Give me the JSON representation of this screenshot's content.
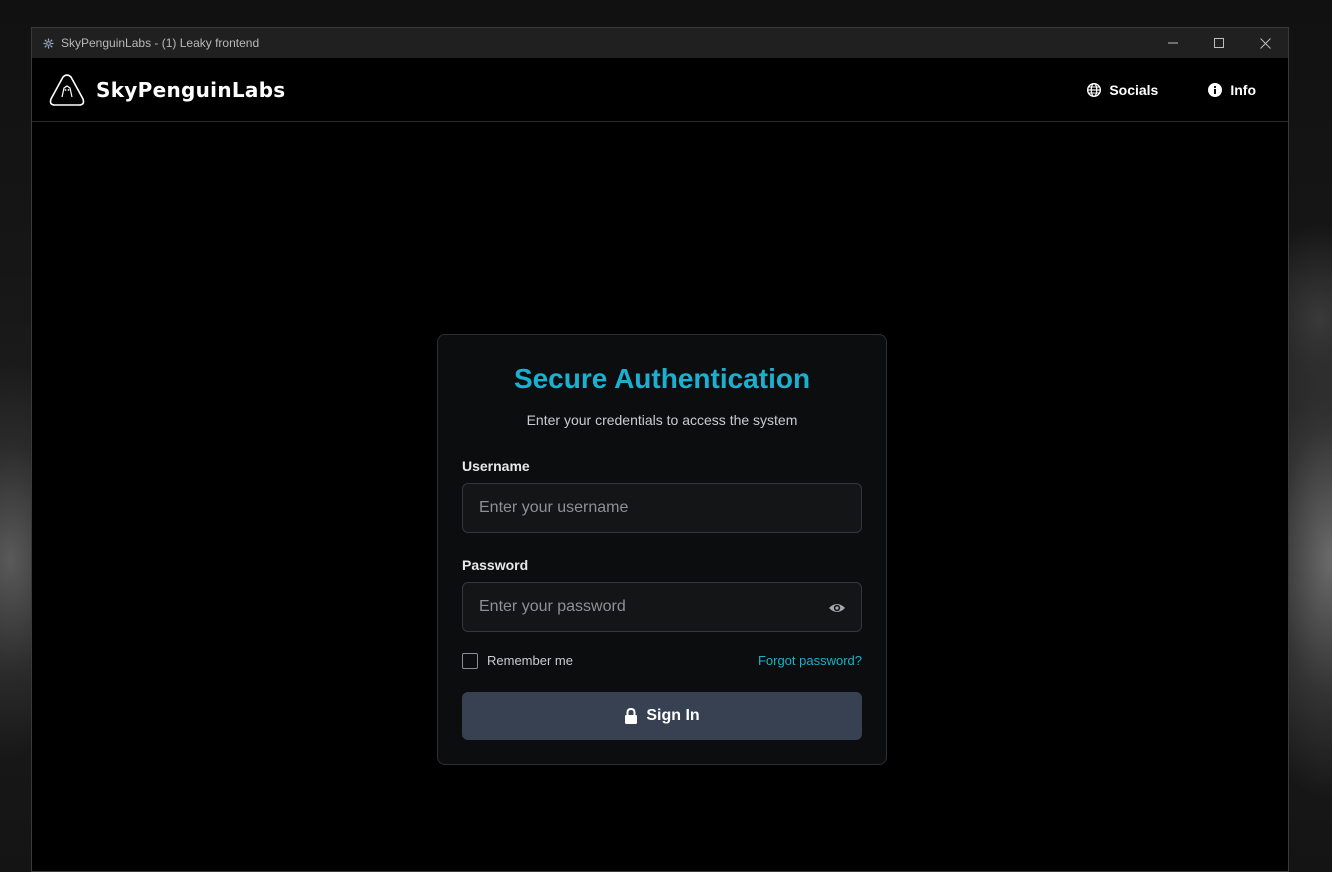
{
  "window": {
    "title": "SkyPenguinLabs - (1) Leaky frontend",
    "minimize_icon": "minimize-icon",
    "maximize_icon": "maximize-icon",
    "close_icon": "close-icon"
  },
  "navbar": {
    "brand": "SkyPenguinLabs",
    "links": [
      {
        "label": "Socials",
        "icon": "globe-icon"
      },
      {
        "label": "Info",
        "icon": "info-icon"
      }
    ]
  },
  "login": {
    "title": "Secure Authentication",
    "subtitle": "Enter your credentials to access the system",
    "username_label": "Username",
    "username_placeholder": "Enter your username",
    "username_value": "",
    "password_label": "Password",
    "password_placeholder": "Enter your password",
    "password_value": "",
    "remember_label": "Remember me",
    "remember_checked": false,
    "forgot_label": "Forgot password?",
    "submit_label": "Sign In",
    "submit_icon": "lock-icon"
  },
  "colors": {
    "accent": "#1ab0cf",
    "button": "#384152",
    "background": "#000000"
  }
}
